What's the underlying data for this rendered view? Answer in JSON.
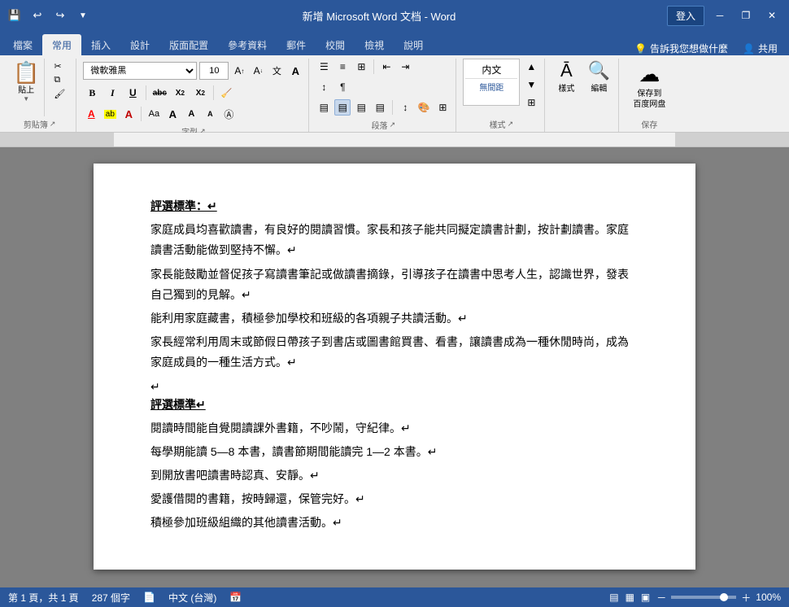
{
  "titleBar": {
    "title": "新增 Microsoft Word 文档 - Word",
    "loginLabel": "登入",
    "icons": {
      "save": "💾",
      "undo": "↩",
      "redo": "↪",
      "customize": "▼"
    },
    "windowControls": {
      "minimize": "─",
      "restore": "❐",
      "close": "✕"
    }
  },
  "ribbon": {
    "tabs": [
      "檔案",
      "常用",
      "插入",
      "設計",
      "版面配置",
      "參考資料",
      "郵件",
      "校閱",
      "檢視",
      "說明"
    ],
    "activeTab": "常用",
    "shareLabel": "共用",
    "helpIcon": "💡",
    "helpLabel": "告訴我您想做什麼",
    "groups": {
      "clipboard": {
        "label": "剪貼簿",
        "paste": "貼上",
        "cut": "✂",
        "copy": "⧉",
        "formatPainter": "🖌"
      },
      "font": {
        "label": "字型",
        "fontName": "微軟雅黑",
        "fontSize": "10",
        "enlargeIcon": "A↑",
        "shrinkIcon": "A↓",
        "specialA": "文",
        "bigA": "A",
        "bold": "B",
        "italic": "I",
        "underline": "U",
        "strikethrough": "abc",
        "subscript": "X₂",
        "superscript": "X²",
        "clearFormat": "🧹",
        "fontColor": "A",
        "highlight": "ab",
        "textColor": "A",
        "capsAa": "Aa",
        "biggerA1": "A",
        "biggerA2": "A",
        "biggerA3": "A",
        "circleA": "Ⓐ"
      },
      "paragraph": {
        "label": "段落",
        "dialogIcon": "↗"
      },
      "styles": {
        "label": "樣式",
        "btn": "樣式",
        "dialogIcon": "↗"
      },
      "edit": {
        "label": "編輯"
      },
      "save": {
        "label": "保存",
        "saveToBaidu": "保存到\n百度网盘"
      }
    },
    "collapseIcon": "▲"
  },
  "document": {
    "paragraphs": [
      {
        "type": "title",
        "text": "評選標準：↵"
      },
      {
        "type": "normal",
        "text": "家庭成員均喜歡讀書，有良好的閱讀習慣。家長和孩子能共同擬定讀書計劃，按計劃讀書。家庭讀書活動能做到堅持不懈。↵"
      },
      {
        "type": "normal",
        "text": "家長能鼓勵並督促孩子寫讀書筆記或做讀書摘錄，引導孩子在讀書中思考人生，認識世界，發表自己獨到的見解。↵"
      },
      {
        "type": "normal",
        "text": "能利用家庭藏書，積極參加學校和班級的各項親子共讀活動。↵"
      },
      {
        "type": "normal",
        "text": "家長經常利用周末或節假日帶孩子到書店或圖書館買書、看書，讓讀書成為一種休閒時尚，成為家庭成員的一種生活方式。↵"
      },
      {
        "type": "blank"
      },
      {
        "type": "title",
        "text": "評選標準↵"
      },
      {
        "type": "normal",
        "text": "閱讀時間能自覺閱讀課外書籍，不吵鬧，守紀律。↵"
      },
      {
        "type": "normal",
        "text": "每學期能讀 5—8 本書，讀書節期間能讀完 1—2 本書。↵"
      },
      {
        "type": "normal",
        "text": "到開放書吧讀書時認真、安靜。↵"
      },
      {
        "type": "normal",
        "text": "愛護借閱的書籍，按時歸還，保管完好。↵"
      },
      {
        "type": "normal",
        "text": "積極參加班級組織的其他讀書活動。↵"
      }
    ]
  },
  "statusBar": {
    "pages": "第 1 頁，共 1 頁",
    "wordCount": "287 個字",
    "editIcon": "📄",
    "language": "中文 (台灣)",
    "calendarIcon": "📅",
    "viewIcons": [
      "▤",
      "▦",
      "▣"
    ],
    "zoom": "100%",
    "zoomMinus": "－",
    "zoomPlus": "＋"
  }
}
